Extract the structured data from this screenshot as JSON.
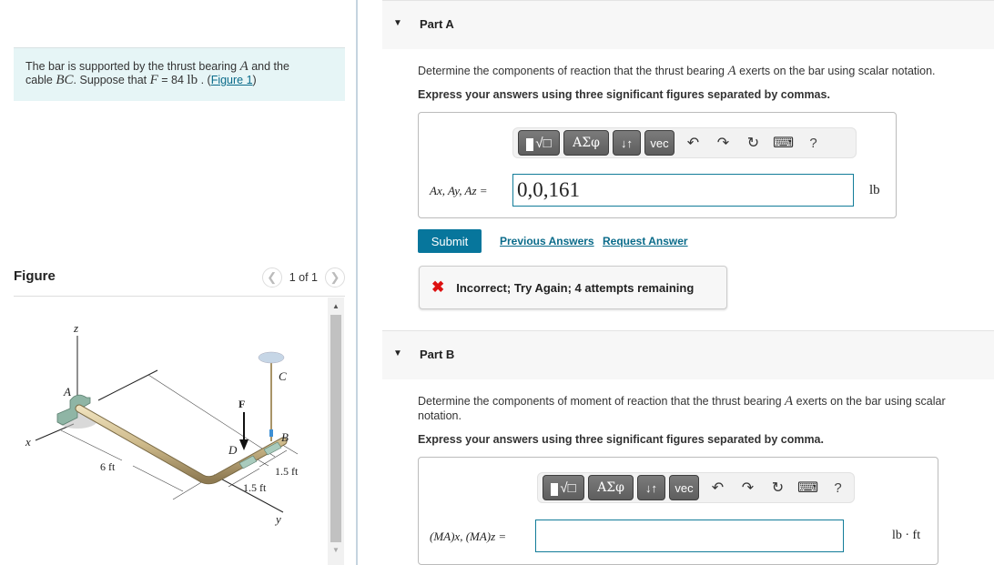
{
  "problem": {
    "text_before_A": "The bar is supported by the thrust bearing ",
    "sym_A": "A",
    "text_after_A": " and the",
    "text_cable": "cable ",
    "sym_BC": "BC",
    "text_suppose": ". Suppose that ",
    "sym_F": "F",
    "text_equals": " = 84 ",
    "unit_F": "lb",
    "text_dot": " . (",
    "figure_link": "Figure 1",
    "text_close": ")"
  },
  "figure": {
    "title": "Figure",
    "pager_text": "1 of 1",
    "prev_icon": "chevron-left",
    "next_icon": "chevron-right",
    "labels": {
      "z": "z",
      "x": "x",
      "y": "y",
      "A": "A",
      "B": "B",
      "C": "C",
      "D": "D",
      "F": "F",
      "dim_6": "6 ft",
      "dim_15a": "1.5 ft",
      "dim_15b": "1.5 ft"
    }
  },
  "colors": {
    "accent": "#07769c",
    "link": "#0a6b8a",
    "error": "#dd1111",
    "problem_bg": "#e6f5f6",
    "input_border": "#127c99"
  },
  "toolbar": {
    "templates_icon": "templates-sqrt-icon",
    "greek_label": "ΑΣφ",
    "arrows_label": "↓↑",
    "vec_label": "vec",
    "undo_icon": "undo",
    "redo_icon": "redo",
    "reset_icon": "reset",
    "keyboard_icon": "keyboard",
    "help_label": "?"
  },
  "partA": {
    "title": "Part A",
    "prompt_before": "Determine the components of reaction that the thrust bearing ",
    "prompt_sym": "A",
    "prompt_after": " exerts on the bar using scalar notation.",
    "instruction": "Express your answers using three significant figures separated by commas.",
    "answer_label": "Ax, Ay, Az =",
    "answer_value": "0,0,161",
    "unit": "lb",
    "submit_label": "Submit",
    "previous_answers_label": "Previous Answers",
    "request_answer_label": "Request Answer",
    "feedback": "Incorrect; Try Again; 4 attempts remaining"
  },
  "partB": {
    "title": "Part B",
    "prompt_before": "Determine the components of moment of reaction that the thrust bearing ",
    "prompt_sym": "A",
    "prompt_after": " exerts on the bar using scalar notation.",
    "instruction": "Express your answers using three significant figures separated by comma.",
    "answer_label": "(MA)x, (MA)z =",
    "answer_value": "",
    "unit": "lb · ft"
  }
}
